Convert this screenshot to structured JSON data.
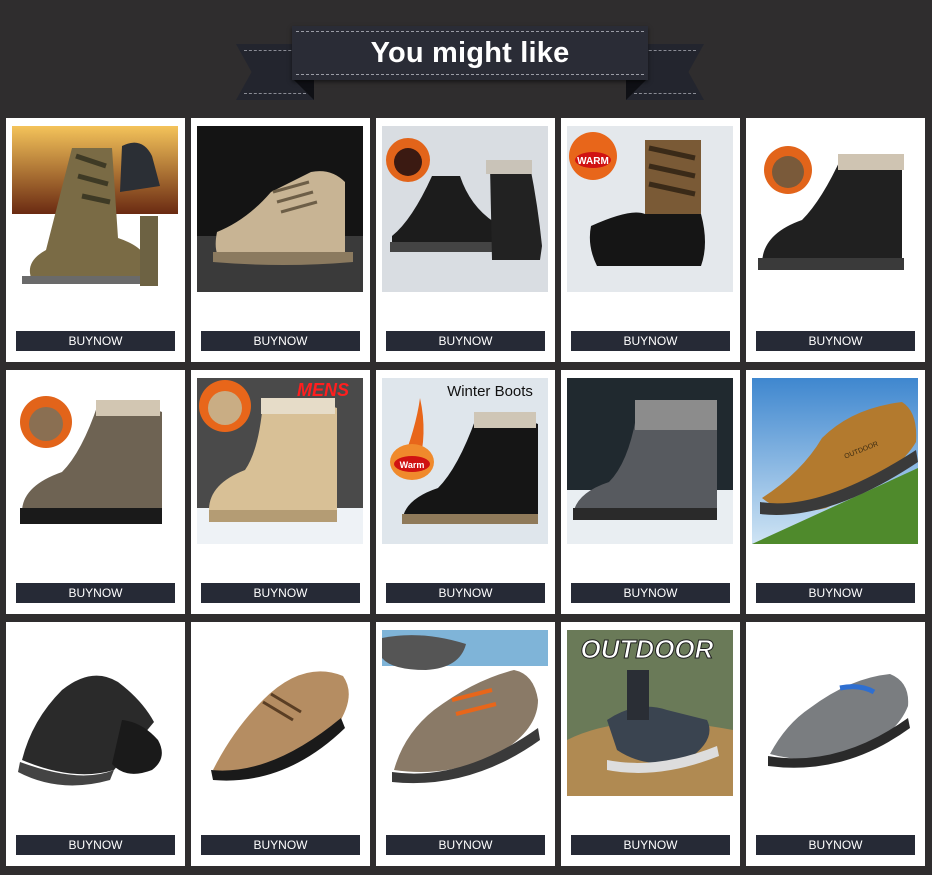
{
  "banner": {
    "title": "You might like"
  },
  "colors": {
    "background": "#2f2d2e",
    "ribbon": "#2a2c36",
    "button": "#262a36"
  },
  "products": [
    {
      "image": "camo-high-boot",
      "button": "BUYNOW"
    },
    {
      "image": "beige-tactical-boot",
      "button": "BUYNOW"
    },
    {
      "image": "black-fur-snow-boot",
      "button": "BUYNOW",
      "badge_icon": "fire-icon"
    },
    {
      "image": "camo-duck-boot",
      "button": "BUYNOW",
      "badge": "WARM"
    },
    {
      "image": "black-fur-boot",
      "button": "BUYNOW",
      "badge_icon": "fire-icon"
    },
    {
      "image": "brown-fur-boot",
      "button": "BUYNOW",
      "badge_icon": "fire-icon"
    },
    {
      "image": "beige-fur-boot",
      "button": "BUYNOW",
      "badge": "MENS"
    },
    {
      "image": "black-winter-boot",
      "button": "BUYNOW",
      "badge": "Warm",
      "caption": "Winter Boots"
    },
    {
      "image": "grey-fur-boot",
      "button": "BUYNOW"
    },
    {
      "image": "tan-hiking-shoe",
      "button": "BUYNOW",
      "logo": "OUTDOOR"
    },
    {
      "image": "black-mesh-sneaker",
      "button": "BUYNOW"
    },
    {
      "image": "brown-casual-shoe",
      "button": "BUYNOW"
    },
    {
      "image": "brown-hiking-shoe",
      "button": "BUYNOW"
    },
    {
      "image": "outdoor-sneaker-photo",
      "button": "BUYNOW",
      "caption": "OUTDOOR"
    },
    {
      "image": "grey-blue-sneaker",
      "button": "BUYNOW"
    }
  ]
}
